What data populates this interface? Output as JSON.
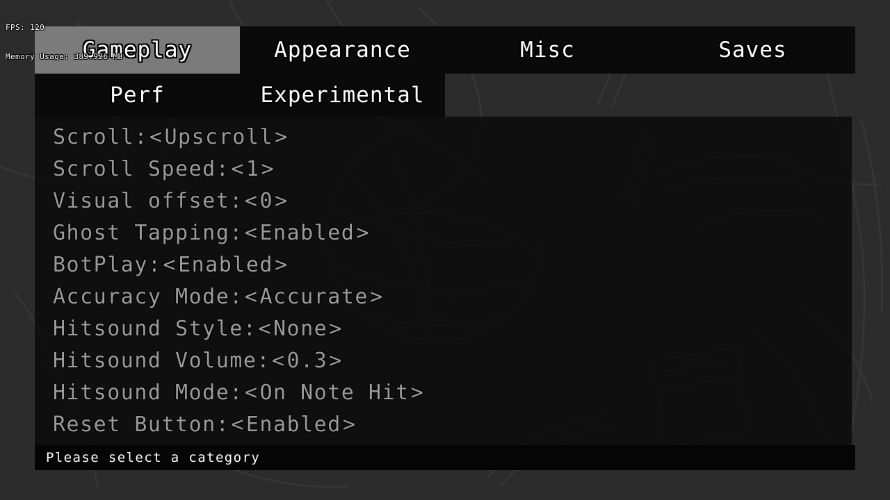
{
  "perf": {
    "fps_line": "FPS: 120",
    "memory_line": "Memory Usage: 389.926 MB"
  },
  "tabs": {
    "row1": [
      {
        "label": "Gameplay",
        "selected": true
      },
      {
        "label": "Appearance",
        "selected": false
      },
      {
        "label": "Misc",
        "selected": false
      },
      {
        "label": "Saves",
        "selected": false
      }
    ],
    "row2": [
      {
        "label": "Perf",
        "selected": false
      },
      {
        "label": "Experimental",
        "selected": false
      }
    ]
  },
  "settings": [
    {
      "label": "Scroll:",
      "left": "<",
      "value": "Upscroll",
      "right": ">"
    },
    {
      "label": "Scroll Speed:",
      "left": "<",
      "value": "1",
      "right": ">"
    },
    {
      "label": "Visual offset:",
      "left": "<",
      "value": "0",
      "right": ">"
    },
    {
      "label": "Ghost Tapping:",
      "left": "<",
      "value": "Enabled",
      "right": ">"
    },
    {
      "label": "BotPlay:",
      "left": "<",
      "value": "Enabled",
      "right": ">"
    },
    {
      "label": "Accuracy Mode:",
      "left": "<",
      "value": "Accurate",
      "right": ">"
    },
    {
      "label": "Hitsound Style:",
      "left": "<",
      "value": "None",
      "right": ">"
    },
    {
      "label": "Hitsound Volume:",
      "left": "<",
      "value": "0.3",
      "right": ">"
    },
    {
      "label": "Hitsound Mode:",
      "left": "<",
      "value": "On Note Hit",
      "right": ">"
    },
    {
      "label": "Reset Button:",
      "left": "<",
      "value": "Enabled",
      "right": ">"
    }
  ],
  "status": {
    "message": "Please select a category"
  },
  "colors": {
    "selected_tab_bg": "#7b7b7b",
    "tab_bar_bg": "#0a0a0a",
    "panel_bg": "#080808",
    "status_bg": "#050505",
    "setting_text": "#9b9b9b",
    "tab_text": "#ffffff",
    "page_bg": "#2c2c2c"
  }
}
